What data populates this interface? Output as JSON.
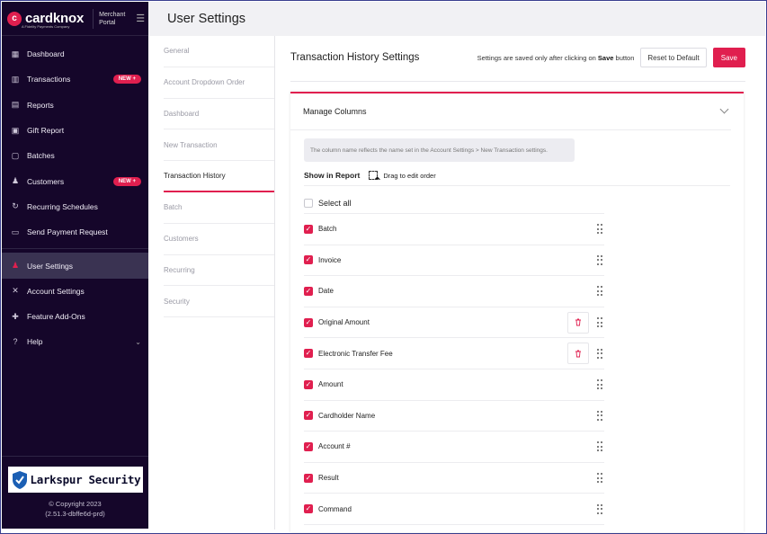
{
  "brand": {
    "name": "cardknox",
    "tagline": "A Fidelity Payments Company",
    "portal_line1": "Merchant",
    "portal_line2": "Portal",
    "accent": "#e01f4f"
  },
  "sidebar": {
    "items": [
      {
        "label": "Dashboard",
        "icon": "dashboard-icon"
      },
      {
        "label": "Transactions",
        "icon": "transactions-icon",
        "badge": "NEW +"
      },
      {
        "label": "Reports",
        "icon": "reports-icon"
      },
      {
        "label": "Gift Report",
        "icon": "gift-icon"
      },
      {
        "label": "Batches",
        "icon": "batches-icon"
      },
      {
        "label": "Customers",
        "icon": "customers-icon",
        "badge": "NEW +"
      },
      {
        "label": "Recurring Schedules",
        "icon": "recurring-icon"
      },
      {
        "label": "Send Payment Request",
        "icon": "payment-request-icon"
      },
      {
        "label": "User Settings",
        "icon": "user-settings-icon",
        "active": true
      },
      {
        "label": "Account Settings",
        "icon": "account-settings-icon"
      },
      {
        "label": "Feature Add-Ons",
        "icon": "puzzle-icon"
      },
      {
        "label": "Help",
        "icon": "help-icon"
      }
    ],
    "footer": {
      "security_brand": "Larkspur Security",
      "copyright": "© Copyright 2023",
      "version": "(2.51.3-dbffe6d-prd)"
    }
  },
  "topbar": {
    "title": "User Settings"
  },
  "subnav": {
    "items": [
      "General",
      "Account Dropdown Order",
      "Dashboard",
      "New Transaction",
      "Transaction History",
      "Batch",
      "Customers",
      "Recurring",
      "Security"
    ],
    "active": "Transaction History"
  },
  "main": {
    "title": "Transaction History Settings",
    "hint_prefix": "Settings are saved only after clicking on",
    "hint_bold": "Save",
    "hint_suffix": "button",
    "reset_label": "Reset to Default",
    "save_label": "Save",
    "section_title": "Manage Columns",
    "info_text": "The column name reflects the name set in the Account Settings > New Transaction settings.",
    "show_in_report": "Show in Report",
    "drag_hint": "Drag to edit order",
    "select_all": "Select all",
    "columns": [
      {
        "name": "Batch",
        "checked": true,
        "deletable": false
      },
      {
        "name": "Invoice",
        "checked": true,
        "deletable": false
      },
      {
        "name": "Date",
        "checked": true,
        "deletable": false
      },
      {
        "name": "Original Amount",
        "checked": true,
        "deletable": true
      },
      {
        "name": "Electronic Transfer Fee",
        "checked": true,
        "deletable": true
      },
      {
        "name": "Amount",
        "checked": true,
        "deletable": false
      },
      {
        "name": "Cardholder Name",
        "checked": true,
        "deletable": false
      },
      {
        "name": "Account #",
        "checked": true,
        "deletable": false
      },
      {
        "name": "Result",
        "checked": true,
        "deletable": false
      },
      {
        "name": "Command",
        "checked": true,
        "deletable": false
      }
    ]
  }
}
